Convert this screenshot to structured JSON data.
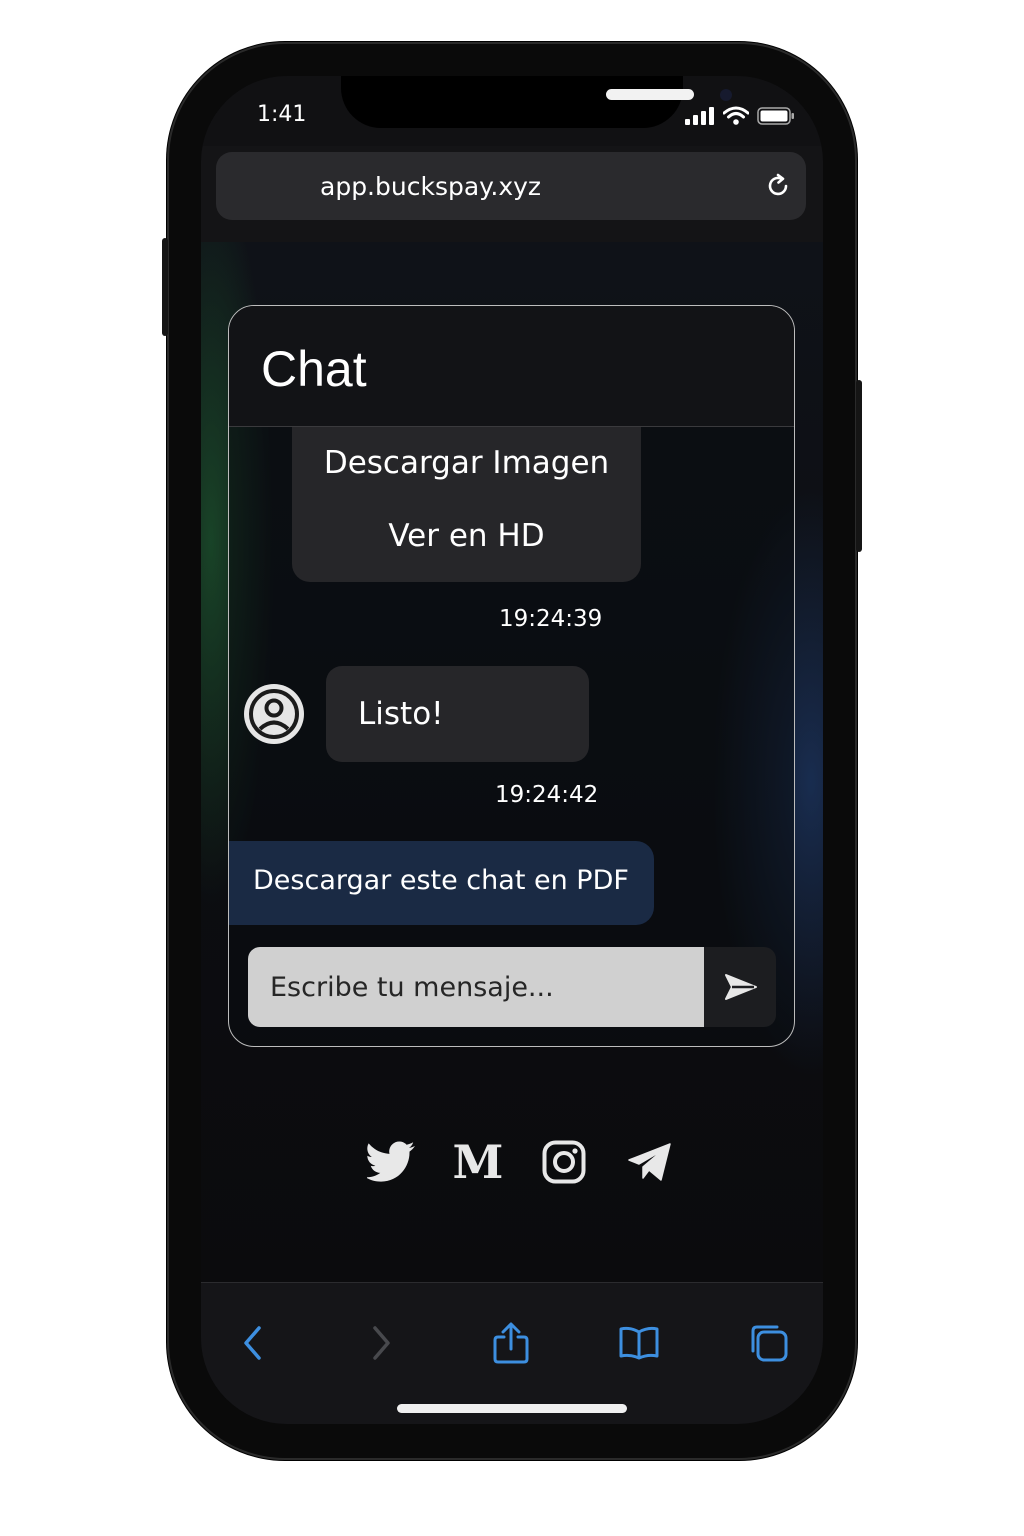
{
  "status_bar": {
    "time": "1:41"
  },
  "browser": {
    "url": "app.buckspay.xyz"
  },
  "chat": {
    "title": "Chat",
    "messages": {
      "image_options": [
        "Descargar Imagen",
        "Ver en HD"
      ],
      "image_timestamp": "19:24:39",
      "listo_text": "Listo!",
      "listo_timestamp": "19:24:42"
    },
    "pdf_button_label": "Descargar este chat en PDF",
    "input_placeholder": "Escribe tu mensaje..."
  },
  "social_icons": [
    "twitter-icon",
    "medium-icon",
    "instagram-icon",
    "telegram-icon"
  ],
  "medium_letter": "M",
  "toolbar_icons": [
    "back-icon",
    "forward-icon",
    "share-icon",
    "bookmarks-icon",
    "tabs-icon"
  ],
  "colors": {
    "accent": "#3d8fe0",
    "pdf_button_bg": "#1a2a44",
    "input_bg": "#d0d0d0"
  }
}
